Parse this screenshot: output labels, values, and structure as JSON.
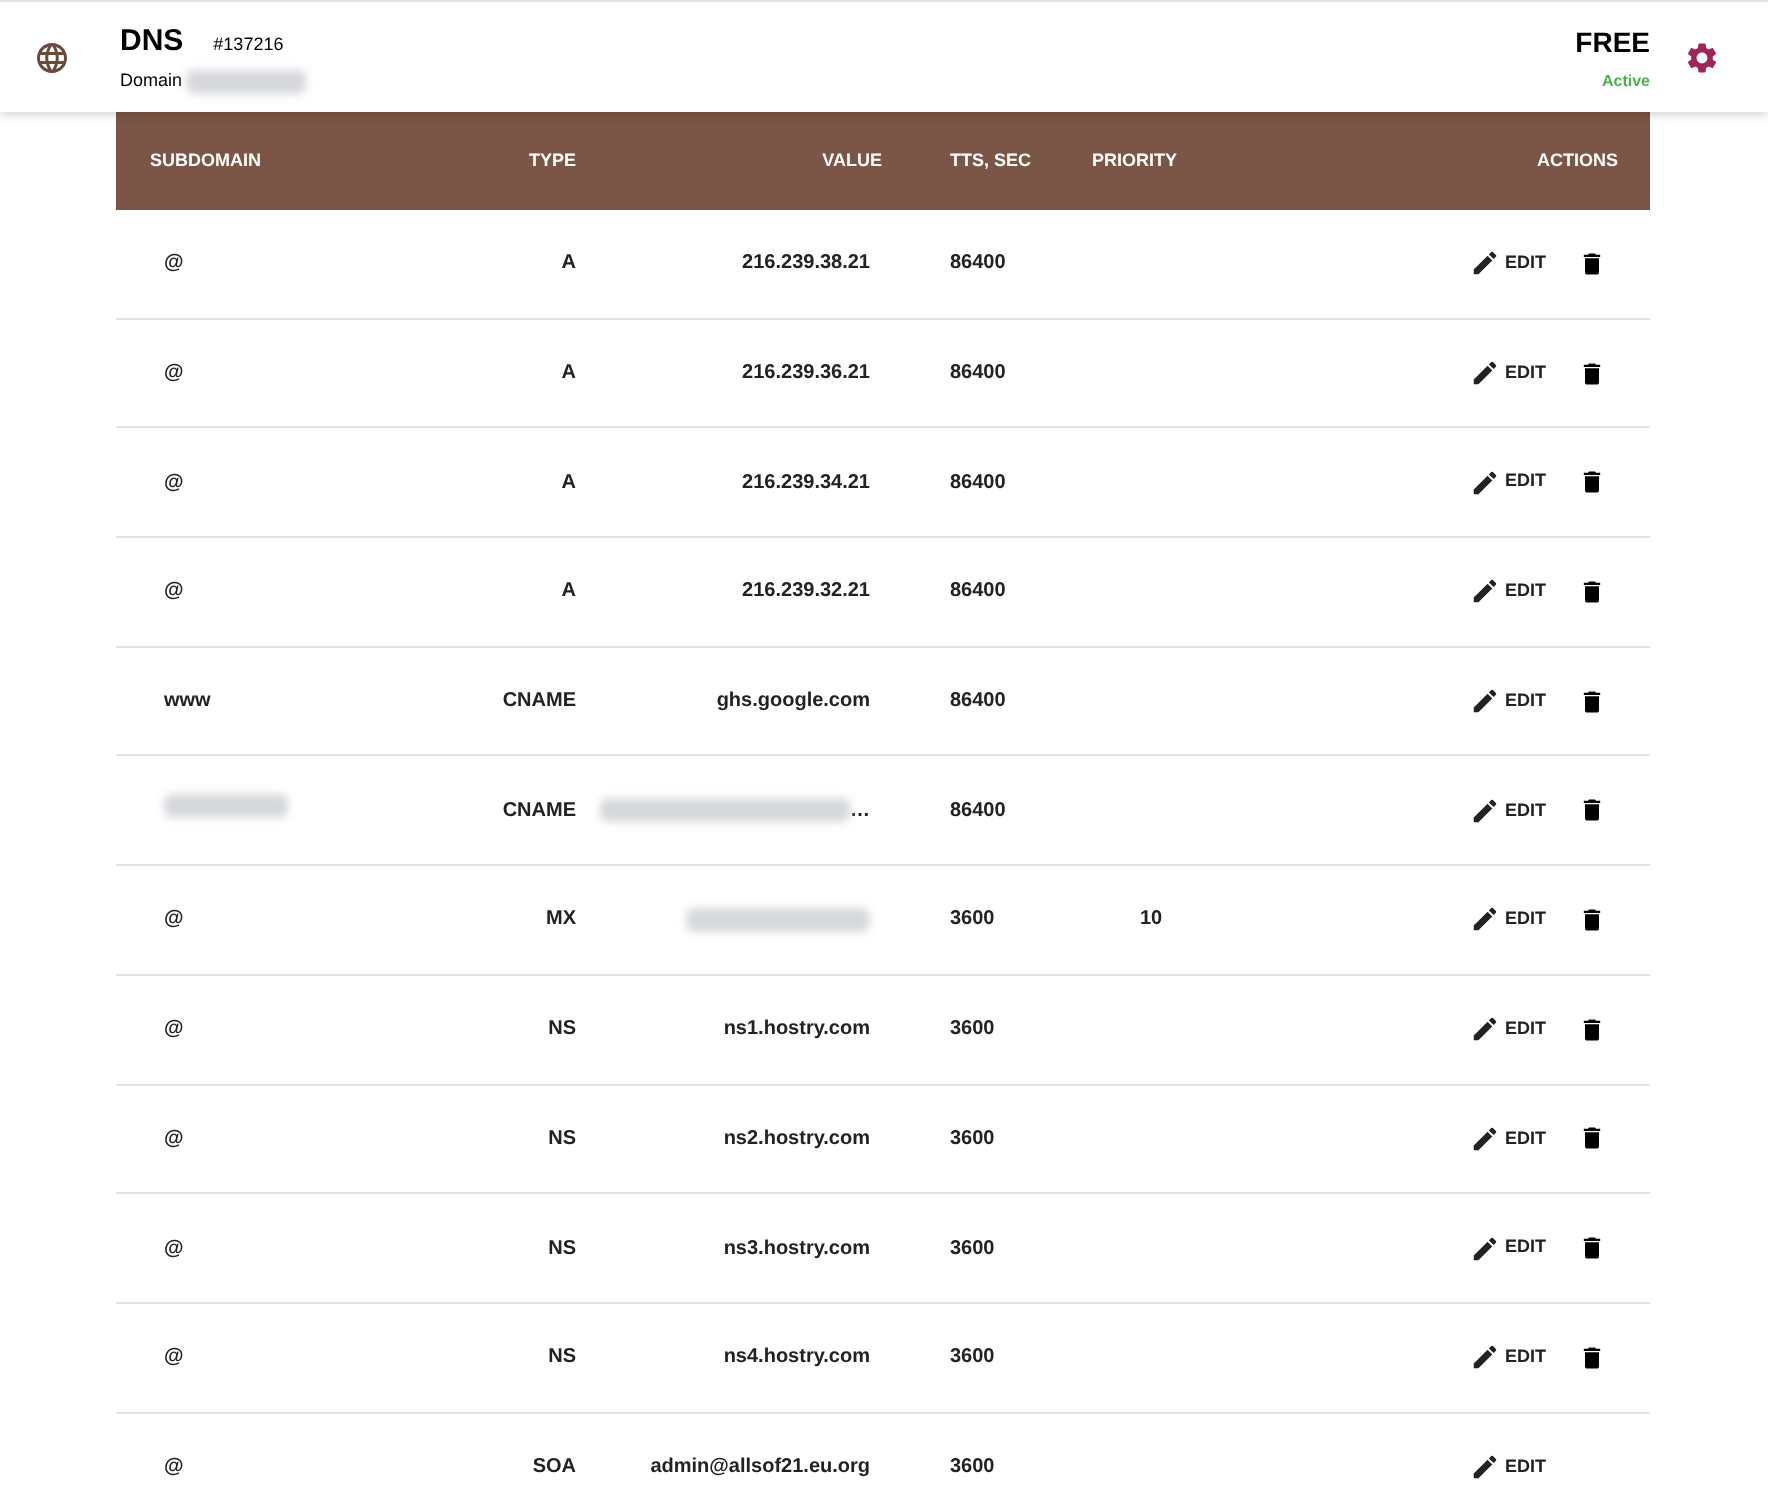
{
  "header": {
    "title": "DNS",
    "id": "#137216",
    "domain_label": "Domain",
    "domain_blurred": true,
    "plan": "FREE",
    "status": "Active"
  },
  "table": {
    "columns": [
      "SUBDOMAIN",
      "TYPE",
      "VALUE",
      "TTS, SEC",
      "PRIORITY",
      "ACTIONS"
    ],
    "rows": [
      {
        "subdomain": "@",
        "subdomain_blurred": false,
        "type": "A",
        "value": "216.239.38.21",
        "value_blurred": false,
        "ttl": "86400",
        "priority": "",
        "edit": "EDIT",
        "deletable": true
      },
      {
        "subdomain": "@",
        "subdomain_blurred": false,
        "type": "A",
        "value": "216.239.36.21",
        "value_blurred": false,
        "ttl": "86400",
        "priority": "",
        "edit": "EDIT",
        "deletable": true
      },
      {
        "subdomain": "@",
        "subdomain_blurred": false,
        "type": "A",
        "value": "216.239.34.21",
        "value_blurred": false,
        "ttl": "86400",
        "priority": "",
        "edit": "EDIT",
        "deletable": true
      },
      {
        "subdomain": "@",
        "subdomain_blurred": false,
        "type": "A",
        "value": "216.239.32.21",
        "value_blurred": false,
        "ttl": "86400",
        "priority": "",
        "edit": "EDIT",
        "deletable": true
      },
      {
        "subdomain": "www",
        "subdomain_blurred": false,
        "type": "CNAME",
        "value": "ghs.google.com",
        "value_blurred": false,
        "ttl": "86400",
        "priority": "",
        "edit": "EDIT",
        "deletable": true
      },
      {
        "subdomain": "",
        "subdomain_blurred": true,
        "type": "CNAME",
        "value": "…",
        "value_blurred": true,
        "ttl": "86400",
        "priority": "",
        "edit": "EDIT",
        "deletable": true
      },
      {
        "subdomain": "@",
        "subdomain_blurred": false,
        "type": "MX",
        "value": "",
        "value_blurred": true,
        "ttl": "3600",
        "priority": "10",
        "edit": "EDIT",
        "deletable": true
      },
      {
        "subdomain": "@",
        "subdomain_blurred": false,
        "type": "NS",
        "value": "ns1.hostry.com",
        "value_blurred": false,
        "ttl": "3600",
        "priority": "",
        "edit": "EDIT",
        "deletable": true
      },
      {
        "subdomain": "@",
        "subdomain_blurred": false,
        "type": "NS",
        "value": "ns2.hostry.com",
        "value_blurred": false,
        "ttl": "3600",
        "priority": "",
        "edit": "EDIT",
        "deletable": true
      },
      {
        "subdomain": "@",
        "subdomain_blurred": false,
        "type": "NS",
        "value": "ns3.hostry.com",
        "value_blurred": false,
        "ttl": "3600",
        "priority": "",
        "edit": "EDIT",
        "deletable": true
      },
      {
        "subdomain": "@",
        "subdomain_blurred": false,
        "type": "NS",
        "value": "ns4.hostry.com",
        "value_blurred": false,
        "ttl": "3600",
        "priority": "",
        "edit": "EDIT",
        "deletable": true
      },
      {
        "subdomain": "@",
        "subdomain_blurred": false,
        "type": "SOA",
        "value": "admin@allsof21.eu.org",
        "value_blurred": false,
        "ttl": "3600",
        "priority": "",
        "edit": "EDIT",
        "deletable": false
      }
    ]
  }
}
